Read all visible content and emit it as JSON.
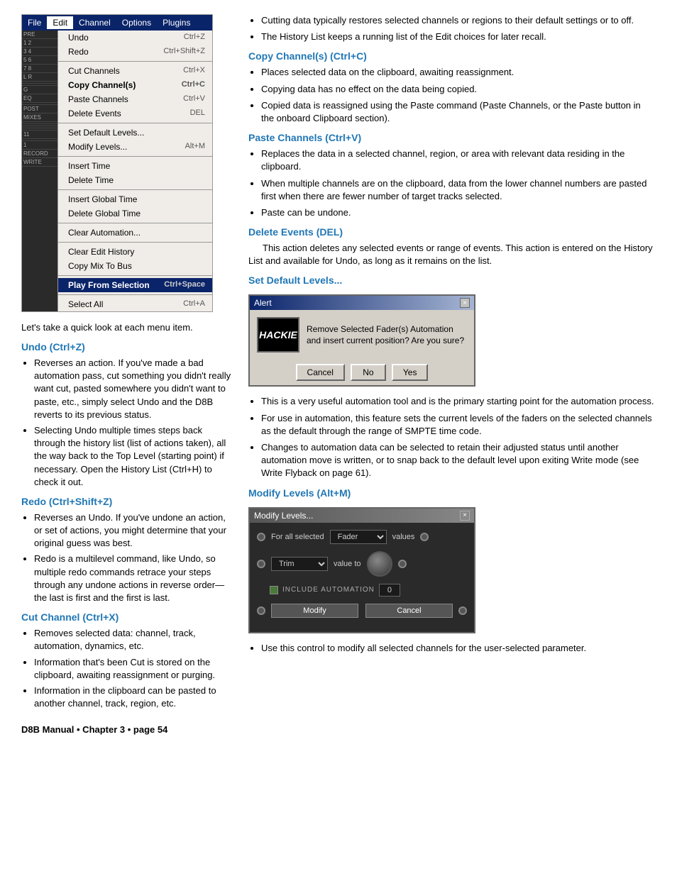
{
  "page": {
    "footer": "D8B Manual • Chapter 3 • page  54"
  },
  "menu": {
    "bar_items": [
      "File",
      "Edit",
      "Channel",
      "Options",
      "Plugins"
    ],
    "active_item": "Edit",
    "items": [
      {
        "label": "Undo",
        "shortcut": "Ctrl+Z",
        "separator_after": false
      },
      {
        "label": "Redo",
        "shortcut": "Ctrl+Shift+Z",
        "separator_after": true
      },
      {
        "label": "Cut Channels",
        "shortcut": "Ctrl+X",
        "separator_after": false
      },
      {
        "label": "Copy Channel(s)",
        "shortcut": "Ctrl+C",
        "separator_after": false
      },
      {
        "label": "Paste Channels",
        "shortcut": "Ctrl+V",
        "separator_after": false
      },
      {
        "label": "Delete Events",
        "shortcut": "DEL",
        "separator_after": true
      },
      {
        "label": "Set Default Levels...",
        "shortcut": "",
        "separator_after": false
      },
      {
        "label": "Modify Levels...",
        "shortcut": "Alt+M",
        "separator_after": true
      },
      {
        "label": "Insert Time",
        "shortcut": "",
        "separator_after": false
      },
      {
        "label": "Delete Time",
        "shortcut": "",
        "separator_after": true
      },
      {
        "label": "Insert Global Time",
        "shortcut": "",
        "separator_after": false
      },
      {
        "label": "Delete Global Time",
        "shortcut": "",
        "separator_after": true
      },
      {
        "label": "Clear Automation...",
        "shortcut": "",
        "separator_after": true
      },
      {
        "label": "Clear Edit History",
        "shortcut": "",
        "separator_after": false
      },
      {
        "label": "Copy Mix To Bus",
        "shortcut": "",
        "separator_after": true
      },
      {
        "label": "Play From Selection",
        "shortcut": "Ctrl+Space",
        "separator_after": true
      },
      {
        "label": "Select All",
        "shortcut": "Ctrl+A",
        "separator_after": false
      }
    ]
  },
  "intro": "Let's take a quick look at each menu item.",
  "sections": {
    "undo": {
      "heading": "Undo (Ctrl+Z)",
      "bullets": [
        "Reverses an action. If you've made a bad automation pass, cut something you didn't really want cut, pasted somewhere you didn't want to paste, etc., simply select Undo and the D8B reverts to its previous status.",
        "Selecting Undo multiple times steps back through the history list (list of actions taken), all the way back to the Top Level (starting point) if necessary. Open the History List (Ctrl+H) to check it out."
      ]
    },
    "redo": {
      "heading": "Redo (Ctrl+Shift+Z)",
      "bullets": [
        "Reverses an Undo. If you've undone an action, or set of actions, you might determine that your original guess was best.",
        "Redo is a multilevel command, like Undo, so multiple redo commands retrace your steps through any undone actions in reverse order—the last is first and the first is last."
      ]
    },
    "cut": {
      "heading": "Cut Channel (Ctrl+X)",
      "bullets": [
        "Removes selected data: channel, track, automation, dynamics, etc.",
        "Information that's been Cut is stored on the clipboard, awaiting reassignment or purging.",
        "Information in the clipboard can be pasted to another channel, track, region, etc."
      ]
    },
    "right_top_bullets": [
      "Cutting data typically restores selected channels or regions to their default settings or to off.",
      "The History List keeps a running list of the Edit choices for later recall."
    ],
    "copy_channels": {
      "heading": "Copy Channel(s) (Ctrl+C)",
      "bullets": [
        "Places selected data on the clipboard, awaiting reassignment.",
        "Copying data has no effect on the data being copied.",
        "Copied data is reassigned using the Paste command (Paste Channels, or the Paste button in the onboard Clipboard section)."
      ]
    },
    "paste_channels": {
      "heading": "Paste Channels (Ctrl+V)",
      "bullets": [
        "Replaces the data in a selected channel, region, or area with relevant data residing in the clipboard.",
        "When multiple channels are on the clipboard, data from the lower channel numbers are pasted first when there are fewer number of target tracks selected.",
        "Paste can be undone."
      ]
    },
    "delete_events": {
      "heading": "Delete Events (DEL)",
      "para": "This action deletes any selected events or range of events. This action is entered on the History List and available for Undo, as long as it remains on the list."
    },
    "set_default": {
      "heading": "Set Default Levels...",
      "alert": {
        "title": "Alert",
        "logo_text": "HACKIE",
        "message": "Remove Selected Fader(s) Automation and insert current position?  Are you sure?",
        "buttons": [
          "Cancel",
          "No",
          "Yes"
        ]
      },
      "bullets": [
        "This is a very useful automation tool and is the primary starting point for the automation process.",
        "For use in automation, this feature sets the current levels of the faders on the selected channels as the default through the range of SMPTE time code.",
        "Changes to automation data can be selected to retain their adjusted status until another automation move is written, or to snap back to the default level upon exiting Write mode (see Write Flyback on page 61)."
      ]
    },
    "modify_levels": {
      "heading": "Modify Levels (Alt+M)",
      "dialog": {
        "title": "Modify Levels...",
        "for_all_selected_label": "For all selected",
        "fader_label": "Fader",
        "values_label": "values",
        "trim_label": "Trim",
        "value_to_label": "value to",
        "include_automation_label": "INCLUDE AUTOMATION",
        "zero_value": "0",
        "buttons": [
          "Modify",
          "Cancel"
        ]
      },
      "bullets": [
        "Use this control to modify all selected channels for the user-selected parameter."
      ]
    }
  }
}
